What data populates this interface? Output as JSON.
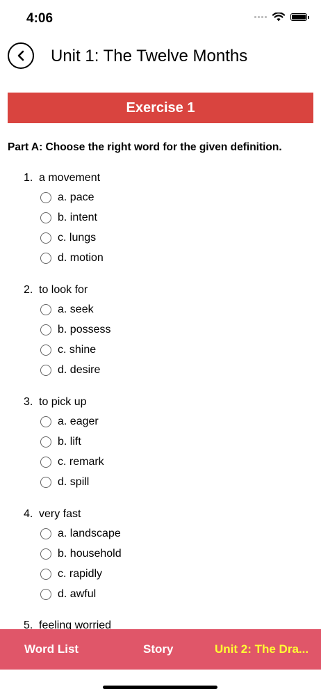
{
  "status": {
    "time": "4:06"
  },
  "nav": {
    "title": "Unit 1: The Twelve Months"
  },
  "exercise": {
    "title": "Exercise 1",
    "part": "Part A: Choose the right word for the given definition."
  },
  "questions": [
    {
      "num": "1.",
      "text": "a movement",
      "options": [
        "a. pace",
        "b. intent",
        "c. lungs",
        "d. motion"
      ]
    },
    {
      "num": "2.",
      "text": "to look for",
      "options": [
        "a. seek",
        "b. possess",
        "c. shine",
        "d. desire"
      ]
    },
    {
      "num": "3.",
      "text": "to pick up",
      "options": [
        "a. eager",
        "b. lift",
        "c. remark",
        "d. spill"
      ]
    },
    {
      "num": "4.",
      "text": "very fast",
      "options": [
        "a. landscape",
        "b. household",
        "c. rapidly",
        "d. awful"
      ]
    },
    {
      "num": "5.",
      "text": "feeling worried",
      "options": []
    }
  ],
  "tabs": {
    "word_list": "Word List",
    "story": "Story",
    "next_unit": "Unit 2: The Dra..."
  },
  "colors": {
    "banner": "#d9443f",
    "bottom_bar": "#e05669",
    "next_unit_text": "#ffff33"
  },
  "icons": {
    "back": "chevron-left-icon",
    "wifi": "wifi-icon",
    "battery": "battery-icon",
    "signal": "signal-icon"
  }
}
